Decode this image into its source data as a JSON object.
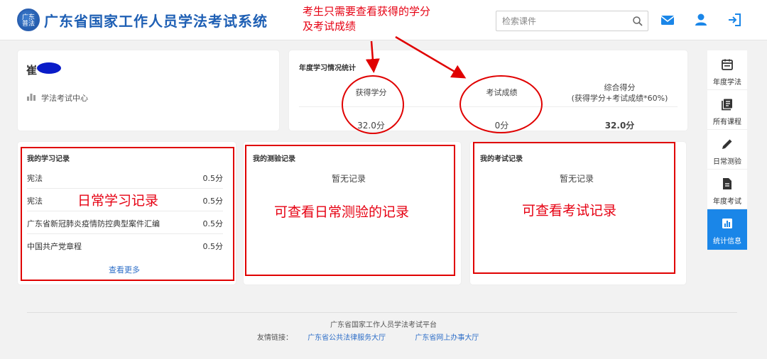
{
  "header": {
    "logo_text": "广东\n普法",
    "title": "广东省国家工作人员学法考试系统",
    "search_placeholder": "检索课件"
  },
  "annotations": {
    "top_note_line1": "考生只需要查看获得的学分",
    "top_note_line2": "及考试成绩",
    "study_records_note": "日常学习记录",
    "quiz_records_note": "可查看日常测验的记录",
    "exam_records_note": "可查看考试记录"
  },
  "profile": {
    "name": "崔",
    "center_link": "学法考试中心"
  },
  "stats": {
    "title": "年度学习情况统计",
    "credits_label": "获得学分",
    "credits_value": "32.0分",
    "exam_label": "考试成绩",
    "exam_value": "0分",
    "total_label": "综合得分",
    "total_formula": "(获得学分+考试成绩*60%)",
    "total_value": "32.0分"
  },
  "study_records": {
    "title": "我的学习记录",
    "rows": [
      {
        "title": "宪法",
        "value": "0.5分"
      },
      {
        "title": "宪法",
        "value": "0.5分"
      },
      {
        "title": "广东省新冠肺炎疫情防控典型案件汇编",
        "value": "0.5分"
      },
      {
        "title": "中国共产党章程",
        "value": "0.5分"
      }
    ],
    "more_label": "查看更多"
  },
  "quiz_records": {
    "title": "我的测验记录",
    "empty_text": "暂无记录"
  },
  "exam_records": {
    "title": "我的考试记录",
    "empty_text": "暂无记录"
  },
  "side_nav": {
    "items": [
      {
        "label": "年度学法",
        "icon": "calendar-icon"
      },
      {
        "label": "所有课程",
        "icon": "book-icon"
      },
      {
        "label": "日常测验",
        "icon": "pencil-icon"
      },
      {
        "label": "年度考试",
        "icon": "document-icon"
      },
      {
        "label": "统计信息",
        "icon": "bar-chart-icon"
      }
    ]
  },
  "footer": {
    "platform": "广东省国家工作人员学法考试平台",
    "links_label": "友情链接：",
    "link1": "广东省公共法律服务大厅",
    "link2": "广东省网上办事大厅"
  },
  "colors": {
    "brand": "#1e5fb4",
    "accent": "#1a86e8",
    "annotation": "#e60012"
  }
}
